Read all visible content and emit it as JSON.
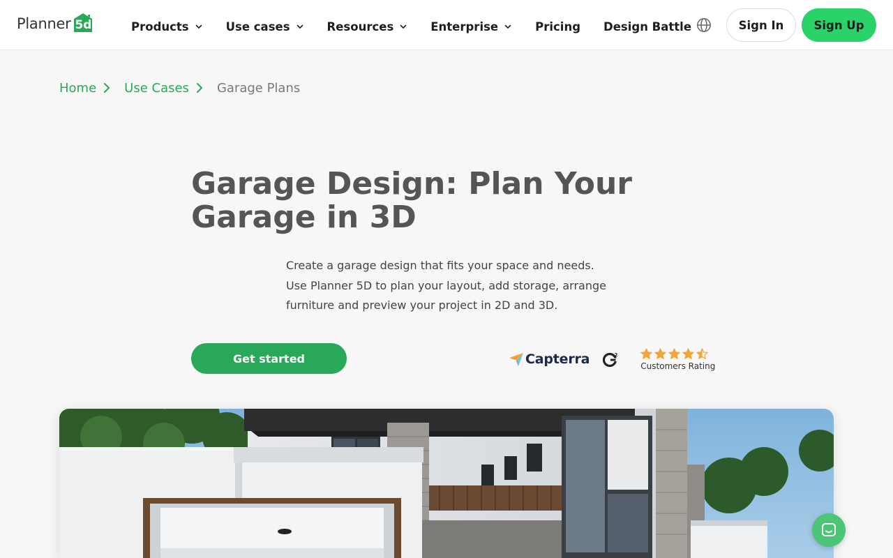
{
  "brand": {
    "name": "Planner",
    "mark": "5d",
    "accent_color": "#2ad26a",
    "link_color": "#2aa85a"
  },
  "nav": {
    "items": [
      {
        "label": "Products",
        "has_dropdown": true
      },
      {
        "label": "Use cases",
        "has_dropdown": true
      },
      {
        "label": "Resources",
        "has_dropdown": true
      },
      {
        "label": "Enterprise",
        "has_dropdown": true
      },
      {
        "label": "Pricing",
        "has_dropdown": false
      },
      {
        "label": "Design Battle",
        "has_dropdown": false
      }
    ],
    "language_icon": "globe-icon",
    "sign_in_label": "Sign In",
    "sign_up_label": "Sign Up"
  },
  "breadcrumb": {
    "items": [
      "Home",
      "Use Cases"
    ],
    "current": "Garage Plans"
  },
  "hero": {
    "title": "Garage Design: Plan Your Garage in 3D",
    "description": "Create a garage design that fits your space and needs. Use Planner 5D to plan your layout, add storage, arrange furniture and preview your project in 2D and 3D.",
    "cta_label": "Get started"
  },
  "ratings": {
    "capterra_label": "Capterra",
    "g2_icon": "g2-logo-icon",
    "stars": 4.5,
    "stars_max": 5,
    "label": "Customers Rating"
  },
  "hero_image": {
    "subject": "garage-house-render"
  },
  "chat": {
    "icon": "chat-icon"
  }
}
